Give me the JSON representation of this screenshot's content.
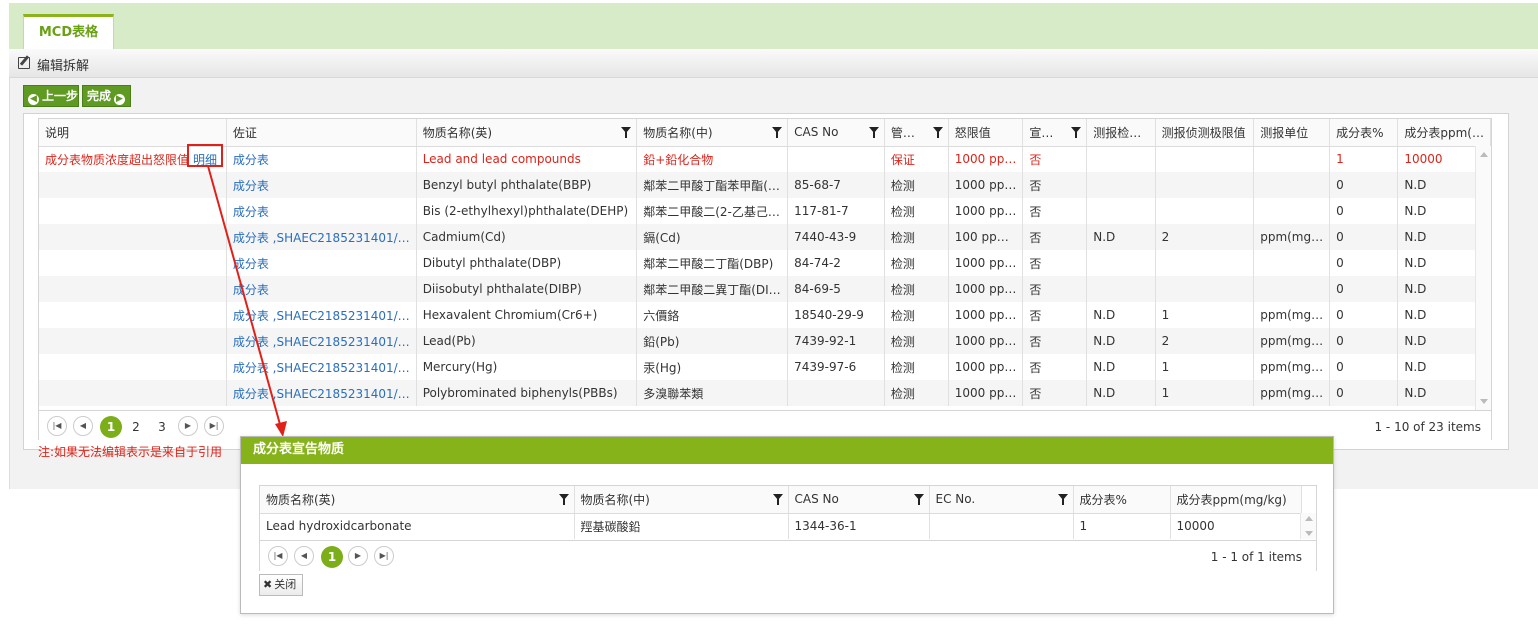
{
  "tab": {
    "label": "MCD表格"
  },
  "toolbar": {
    "edit_label": "编辑拆解"
  },
  "buttons": {
    "prev": "上一步",
    "done": "完成"
  },
  "main_grid": {
    "columns": [
      "说明",
      "佐证",
      "物质名称(英)",
      "物质名称(中)",
      "CAS No",
      "管…",
      "怒限值",
      "宣…",
      "测报检…",
      "测报侦测极限值",
      "测报单位",
      "成分表%",
      "成分表ppm(…"
    ],
    "rows": [
      [
        "成分表物质浓度超出怒限值",
        "成分表",
        "Lead and lead compounds",
        "鉛+鉛化合物",
        "",
        "保证",
        "1000 pp…",
        "否",
        "",
        "",
        "",
        "1",
        "10000"
      ],
      [
        "",
        "成分表",
        "Benzyl butyl phthalate(BBP)",
        "鄰苯二甲酸丁酯苯甲酯(…",
        "85-68-7",
        "检测",
        "1000 pp…",
        "否",
        "",
        "",
        "",
        "0",
        "N.D"
      ],
      [
        "",
        "成分表",
        "Bis (2-ethylhexyl)phthalate(DEHP)",
        "鄰苯二甲酸二(2-乙基己…",
        "117-81-7",
        "检测",
        "1000 pp…",
        "否",
        "",
        "",
        "",
        "0",
        "N.D"
      ],
      [
        "",
        "成分表 ,SHAEC2185231401/…",
        "Cadmium(Cd)",
        "鎘(Cd)",
        "7440-43-9",
        "检测",
        "100 pp…",
        "否",
        "N.D",
        "2",
        "ppm(mg…",
        "0",
        "N.D"
      ],
      [
        "",
        "成分表",
        "Dibutyl phthalate(DBP)",
        "鄰苯二甲酸二丁酯(DBP)",
        "84-74-2",
        "检测",
        "1000 pp…",
        "否",
        "",
        "",
        "",
        "0",
        "N.D"
      ],
      [
        "",
        "成分表",
        "Diisobutyl phthalate(DIBP)",
        "鄰苯二甲酸二異丁酯(DI…",
        "84-69-5",
        "检测",
        "1000 pp…",
        "否",
        "",
        "",
        "",
        "0",
        "N.D"
      ],
      [
        "",
        "成分表 ,SHAEC2185231401/…",
        "Hexavalent Chromium(Cr6+)",
        "六價鉻",
        "18540-29-9",
        "检测",
        "1000 pp…",
        "否",
        "N.D",
        "1",
        "ppm(mg…",
        "0",
        "N.D"
      ],
      [
        "",
        "成分表 ,SHAEC2185231401/…",
        "Lead(Pb)",
        "鉛(Pb)",
        "7439-92-1",
        "检测",
        "1000 pp…",
        "否",
        "N.D",
        "2",
        "ppm(mg…",
        "0",
        "N.D"
      ],
      [
        "",
        "成分表 ,SHAEC2185231401/…",
        "Mercury(Hg)",
        "汞(Hg)",
        "7439-97-6",
        "检测",
        "1000 pp…",
        "否",
        "N.D",
        "1",
        "ppm(mg…",
        "0",
        "N.D"
      ],
      [
        "",
        "成分表 ,SHAEC2185231401/…",
        "Polybrominated biphenyls(PBBs)",
        "多溴聯苯類",
        "",
        "检测",
        "1000 pp…",
        "否",
        "N.D",
        "1",
        "ppm(mg…",
        "0",
        "N.D"
      ]
    ],
    "detail_link": "明细",
    "pager": {
      "pages": [
        "1",
        "2",
        "3"
      ],
      "current": "1",
      "info": "1 - 10 of 23 items"
    }
  },
  "note": "注:如果无法编辑表示是来自于引用",
  "dialog": {
    "title": "成分表宣告物质",
    "columns": [
      "物质名称(英)",
      "物质名称(中)",
      "CAS No",
      "EC No.",
      "成分表%",
      "成分表ppm(mg/kg)"
    ],
    "rows": [
      [
        "Lead hydroxidcarbonate",
        "羥基碳酸鉛",
        "1344-36-1",
        "",
        "1",
        "10000"
      ]
    ],
    "pager": {
      "current": "1",
      "info": "1 - 1 of 1 items"
    },
    "close_label": "关闭"
  },
  "colors": {
    "accent_green": "#86b31a",
    "warning_red": "#d9261c",
    "link_blue": "#2a6ebb"
  }
}
